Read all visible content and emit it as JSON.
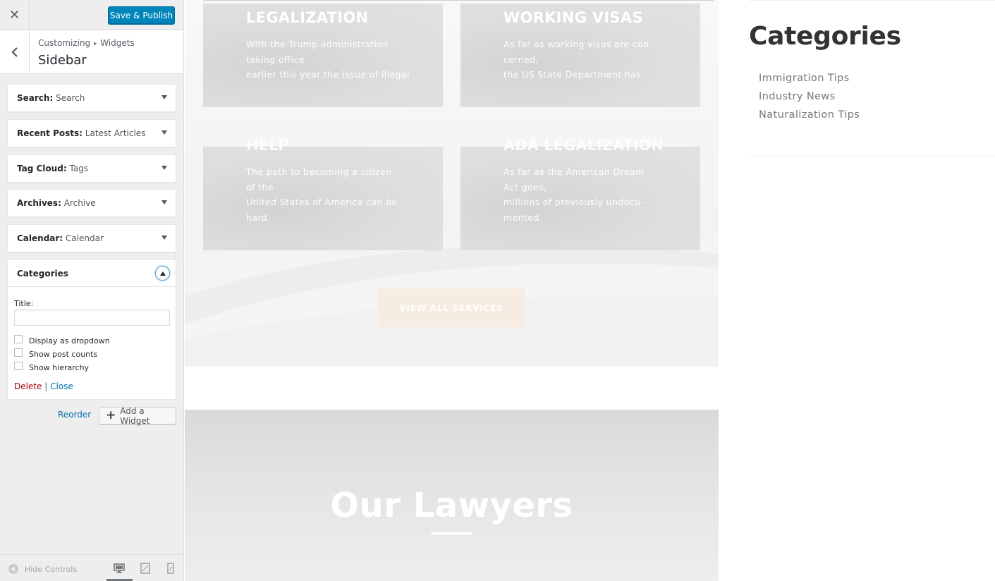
{
  "customizer": {
    "close_symbol": "✕",
    "save_publish_label": "Save & Publish",
    "breadcrumb": {
      "parent": "Customizing",
      "separator": "▸",
      "child": "Widgets"
    },
    "section_title": "Sidebar",
    "widgets": [
      {
        "type": "Search",
        "instance": "Search"
      },
      {
        "type": "Recent Posts",
        "instance": "Latest Articles"
      },
      {
        "type": "Tag Cloud",
        "instance": "Tags"
      },
      {
        "type": "Archives",
        "instance": "Archive"
      },
      {
        "type": "Calendar",
        "instance": "Calendar"
      }
    ],
    "open_widget": {
      "type": "Categories",
      "title_label": "Title:",
      "title_value": "",
      "checkboxes": [
        {
          "label": "Display as dropdown",
          "checked": false
        },
        {
          "label": "Show post counts",
          "checked": false
        },
        {
          "label": "Show hierarchy",
          "checked": false
        }
      ],
      "delete_label": "Delete",
      "separator": "|",
      "close_label": "Close"
    },
    "reorder_label": "Reorder",
    "add_widget_label": "Add a Widget",
    "footer": {
      "hide_controls_label": "Hide Controls",
      "active_device": "desktop",
      "devices": [
        "desktop-icon",
        "tablet-icon",
        "mobile-icon"
      ]
    }
  },
  "preview": {
    "services": [
      {
        "title": "LEGALIZATION",
        "lines": [
          "With the Trump administration",
          "taking office",
          "earlier this year,the issue of illegal"
        ]
      },
      {
        "title": "WORKING VISAS",
        "lines": [
          "As far as working visas are con-",
          "cerned,",
          "the US State Department has"
        ]
      },
      {
        "title": "HELP",
        "lines": [
          "The path to becoming a citizen",
          "of the",
          "United States of America can be",
          "hard"
        ]
      },
      {
        "title": "ADA LEGALIZATION",
        "lines": [
          "As far as the American Dream",
          "Act goes,",
          "millions of previously undocu-",
          "mented"
        ]
      }
    ],
    "view_all_label": "VIEW ALL SERVICES",
    "lawyers_title": "Our Lawyers",
    "sidebar_categories": {
      "title": "Categories",
      "items": [
        "Immigration Tips",
        "Industry News",
        "Naturalization Tips"
      ]
    }
  },
  "colors": {
    "primary_button": "#0085ba",
    "link": "#0073aa",
    "delete": "#a00000",
    "view_all_bg": "#f6ece1"
  }
}
